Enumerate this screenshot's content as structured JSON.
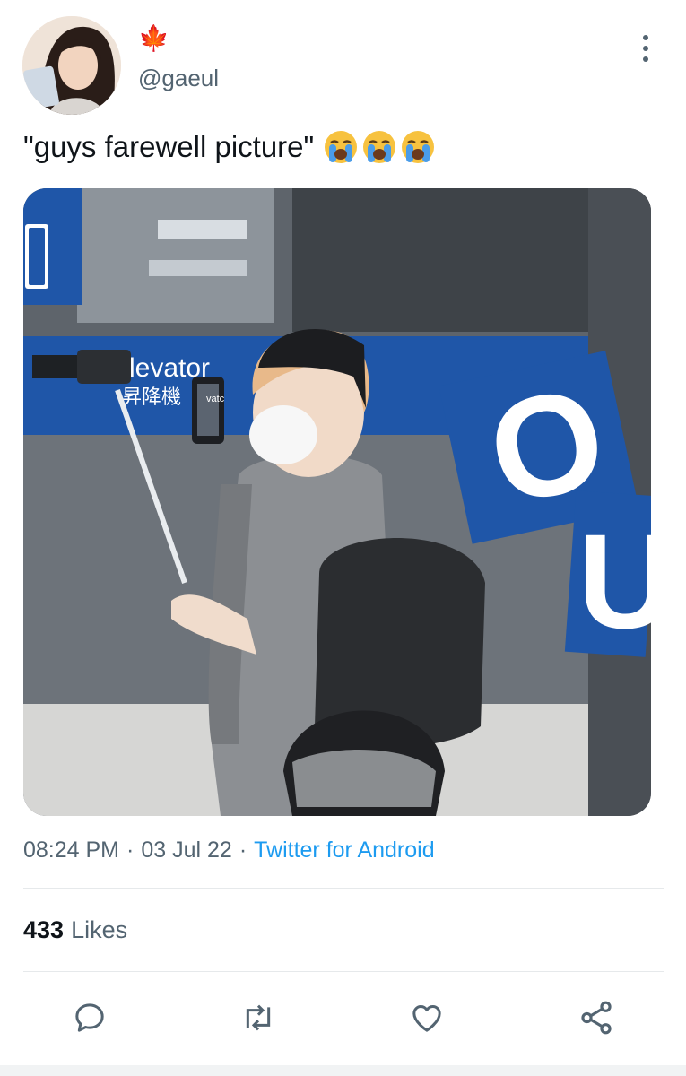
{
  "author": {
    "display_name_icon": "maple-leaf-icon",
    "display_name_emoji": "🍁",
    "handle": "@gaeul"
  },
  "tweet": {
    "text": "\"guys farewell picture\"",
    "emoji_icons": [
      "loudly-crying-face-icon",
      "loudly-crying-face-icon",
      "loudly-crying-face-icon"
    ]
  },
  "photo": {
    "sign_text_en": "levator",
    "sign_text_cn": "昇降機",
    "phone_text": "vatc",
    "letters": [
      "O",
      "U"
    ]
  },
  "meta": {
    "time": "08:24 PM",
    "date": "03 Jul 22",
    "separator": "·",
    "source": "Twitter for Android"
  },
  "stats": {
    "likes_count": "433",
    "likes_label": "Likes"
  },
  "actions": [
    {
      "name": "reply",
      "icon": "speech-bubble-icon"
    },
    {
      "name": "retweet",
      "icon": "retweet-icon"
    },
    {
      "name": "like",
      "icon": "heart-icon"
    },
    {
      "name": "share",
      "icon": "share-icon"
    }
  ],
  "colors": {
    "text": "#0f1419",
    "secondary": "#536471",
    "link": "#1d9bf0",
    "sign_blue": "#1f56a8"
  }
}
